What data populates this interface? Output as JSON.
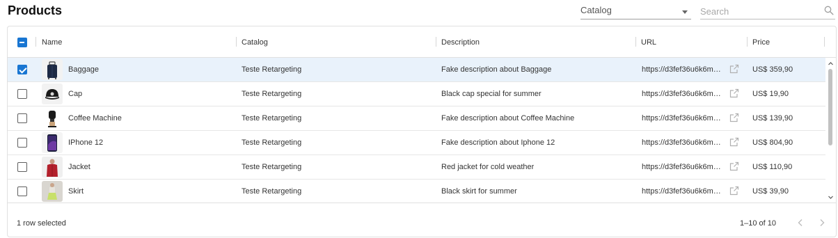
{
  "page": {
    "title": "Products"
  },
  "toolbar": {
    "catalog_select": {
      "label": "Catalog"
    },
    "search": {
      "placeholder": "Search",
      "value": ""
    }
  },
  "table": {
    "columns": [
      "Name",
      "Catalog",
      "Description",
      "URL",
      "Price"
    ],
    "header_checkbox_state": "indeterminate",
    "rows": [
      {
        "selected": true,
        "thumbnail": "baggage-image",
        "name": "Baggage",
        "catalog": "Teste Retargeting",
        "description": "Fake description about Baggage",
        "url": "https://d3fef36u6k6m…",
        "price": "US$ 359,90"
      },
      {
        "selected": false,
        "thumbnail": "cap-image",
        "name": "Cap",
        "catalog": "Teste Retargeting",
        "description": "Black cap special for summer",
        "url": "https://d3fef36u6k6m…",
        "price": "US$ 19,90"
      },
      {
        "selected": false,
        "thumbnail": "coffee-machine-image",
        "name": "Coffee Machine",
        "catalog": "Teste Retargeting",
        "description": "Fake description about Coffee Machine",
        "url": "https://d3fef36u6k6m…",
        "price": "US$ 139,90"
      },
      {
        "selected": false,
        "thumbnail": "iphone-image",
        "name": "IPhone 12",
        "catalog": "Teste Retargeting",
        "description": "Fake description about Iphone 12",
        "url": "https://d3fef36u6k6m…",
        "price": "US$ 804,90"
      },
      {
        "selected": false,
        "thumbnail": "jacket-image",
        "name": "Jacket",
        "catalog": "Teste Retargeting",
        "description": "Red jacket for cold weather",
        "url": "https://d3fef36u6k6m…",
        "price": "US$ 110,90"
      },
      {
        "selected": false,
        "thumbnail": "skirt-image",
        "name": "Skirt",
        "catalog": "Teste Retargeting",
        "description": "Black skirt for summer",
        "url": "https://d3fef36u6k6m…",
        "price": "US$ 39,90"
      }
    ]
  },
  "footer": {
    "selection_text": "1 row selected",
    "pagination_text": "1–10 of 10"
  },
  "colors": {
    "accent": "#1976d2",
    "selected_row": "#e9f2fb",
    "border": "#e0e0e0"
  }
}
